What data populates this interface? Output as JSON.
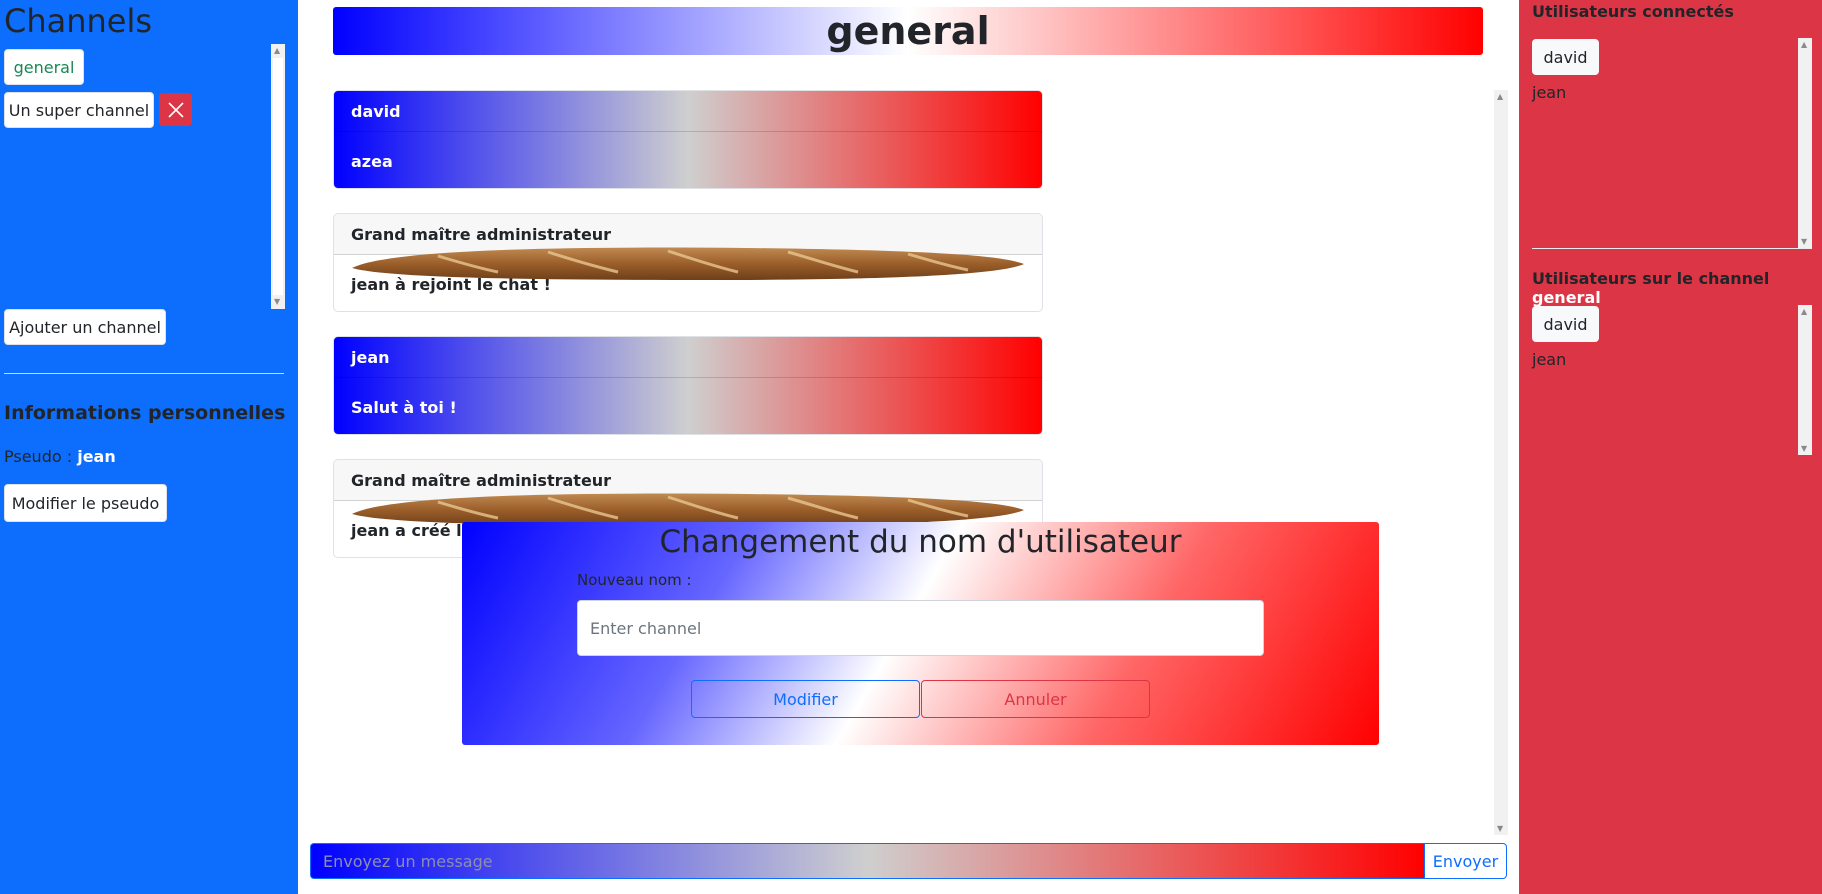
{
  "sidebar": {
    "title": "Channels",
    "channels": [
      {
        "label": "general"
      },
      {
        "label": "Un super channel"
      }
    ],
    "add_channel_label": "Ajouter un channel",
    "info_title": "Informations personnelles",
    "pseudo_label": "Pseudo :",
    "pseudo_value": "jean",
    "modify_pseudo_label": "Modifier le pseudo"
  },
  "main": {
    "channel_title": "general",
    "messages": [
      {
        "author": "david",
        "text": "azea",
        "style": "user"
      },
      {
        "author": "Grand maître administrateur",
        "text": "jean à rejoint le chat !",
        "style": "admin"
      },
      {
        "author": "jean",
        "text": "Salut à toi !",
        "style": "user"
      },
      {
        "author": "Grand maître administrateur",
        "text": "jean a créé le channel",
        "style": "admin"
      }
    ],
    "message_placeholder": "Envoyez un message",
    "send_label": "Envoyer"
  },
  "modal": {
    "title": "Changement du nom d'utilisateur",
    "label": "Nouveau nom :",
    "placeholder": "Enter channel",
    "confirm_label": "Modifier",
    "cancel_label": "Annuler"
  },
  "rightbar": {
    "connected_title": "Utilisateurs connectés",
    "connected_users": [
      "david",
      "jean"
    ],
    "channel_users_title": "Utilisateurs sur le channel",
    "channel_name": "general",
    "channel_users": [
      "david",
      "jean"
    ]
  },
  "colors": {
    "primary": "#0d6efd",
    "danger": "#dc3545",
    "success": "#198754"
  },
  "icons": {
    "delete_channel": "close-icon",
    "admin_avatar": "baguette-icon"
  }
}
